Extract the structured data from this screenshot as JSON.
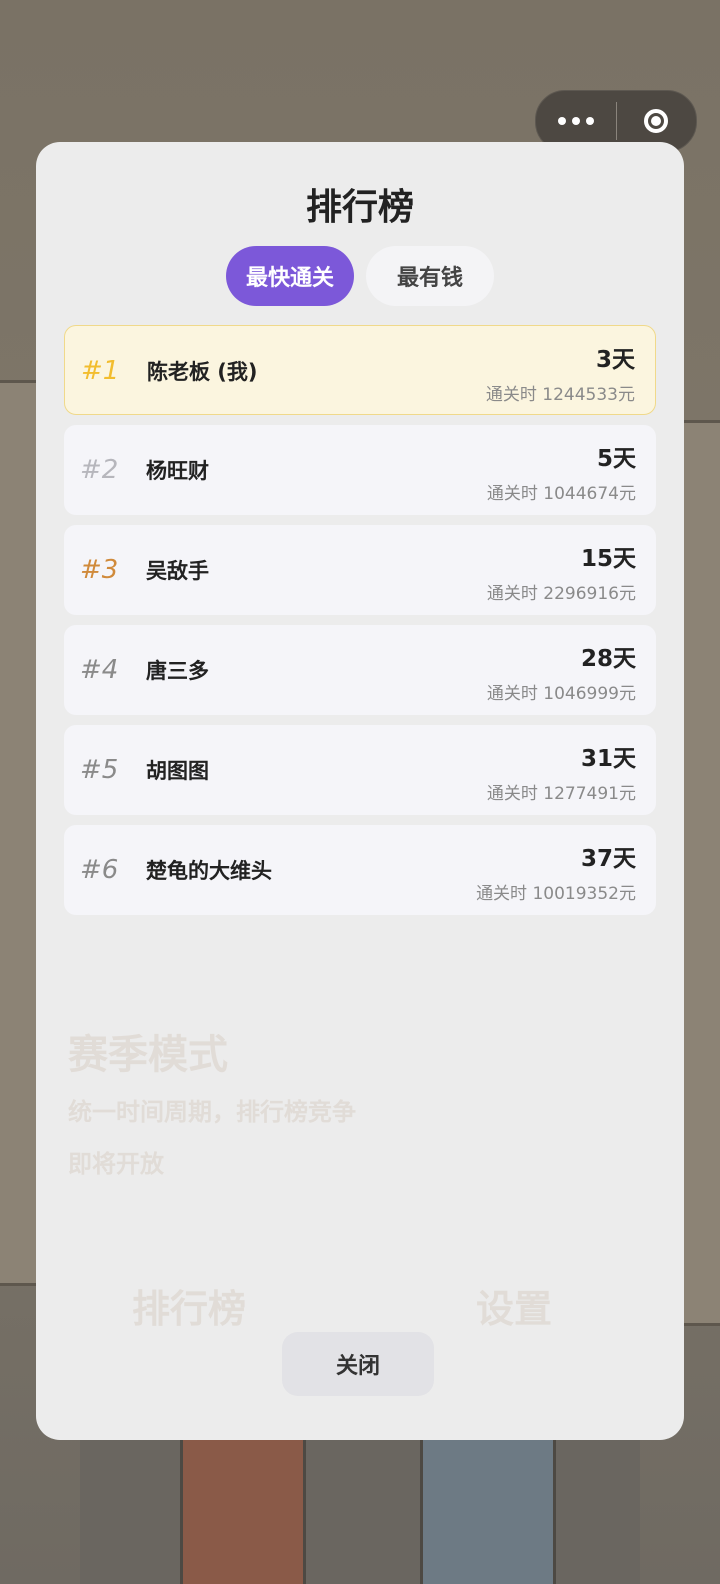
{
  "modal": {
    "title": "排行榜",
    "tabs": [
      {
        "label": "最快通关",
        "active": true
      },
      {
        "label": "最有钱",
        "active": false
      }
    ],
    "close_label": "关闭"
  },
  "leaderboard": [
    {
      "rank": "#1",
      "name": "陈老板 (我)",
      "days": "3天",
      "money": "通关时 1244533元",
      "is_me": true
    },
    {
      "rank": "#2",
      "name": "杨旺财",
      "days": "5天",
      "money": "通关时 1044674元",
      "is_me": false
    },
    {
      "rank": "#3",
      "name": "吴敌手",
      "days": "15天",
      "money": "通关时 2296916元",
      "is_me": false
    },
    {
      "rank": "#4",
      "name": "唐三多",
      "days": "28天",
      "money": "通关时 1046999元",
      "is_me": false
    },
    {
      "rank": "#5",
      "name": "胡图图",
      "days": "31天",
      "money": "通关时 1277491元",
      "is_me": false
    },
    {
      "rank": "#6",
      "name": "楚龟的大维头",
      "days": "37天",
      "money": "通关时 10019352元",
      "is_me": false
    }
  ],
  "background": {
    "season_title": "赛季模式",
    "season_desc": "统一时间周期，排行榜竞争",
    "season_status": "即将开放",
    "btn_leaderboard": "排行榜",
    "btn_settings": "设置"
  },
  "colors": {
    "accent": "#7c58d9",
    "gold": "#f2bd2e",
    "silver": "#b6b6bc",
    "bronze": "#d08a3b",
    "highlight_row": "#fbf5df"
  },
  "icons": {
    "capsule_more": "more-dots-icon",
    "capsule_close": "target-circle-icon"
  }
}
